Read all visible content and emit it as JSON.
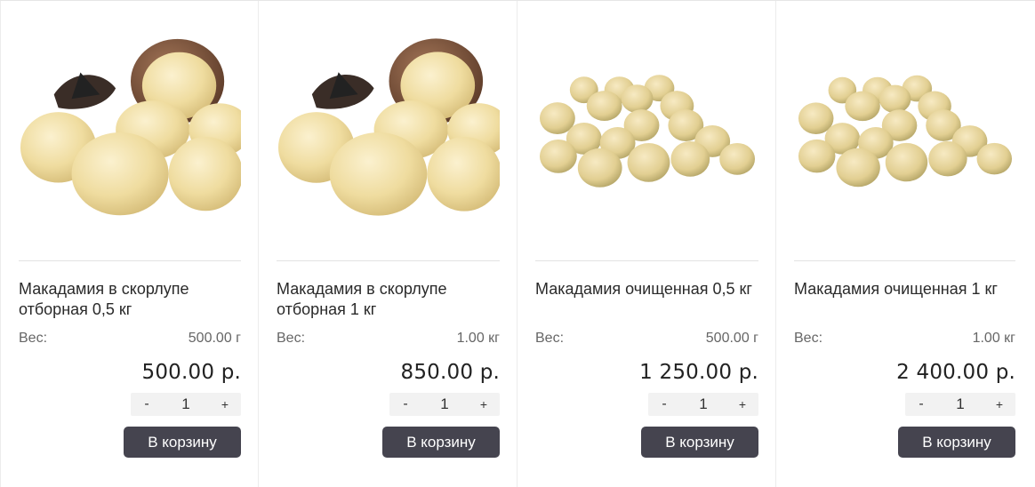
{
  "products": [
    {
      "title": "Макадамия в скорлупе отборная 0,5 кг",
      "weight_label": "Вес:",
      "weight_value": "500.00 г",
      "price": "500.00 р.",
      "qty": "1",
      "minus": "-",
      "plus": "+",
      "cart": "В корзину",
      "image": "macadamia-in-shell"
    },
    {
      "title": "Макадамия в скорлупе отборная 1 кг",
      "weight_label": "Вес:",
      "weight_value": "1.00 кг",
      "price": "850.00 р.",
      "qty": "1",
      "minus": "-",
      "plus": "+",
      "cart": "В корзину",
      "image": "macadamia-in-shell"
    },
    {
      "title": "Макадамия очищенная 0,5 кг",
      "weight_label": "Вес:",
      "weight_value": "500.00 г",
      "price": "1 250.00 р.",
      "qty": "1",
      "minus": "-",
      "plus": "+",
      "cart": "В корзину",
      "image": "macadamia-shelled"
    },
    {
      "title": "Макадамия очищенная 1 кг",
      "weight_label": "Вес:",
      "weight_value": "1.00 кг",
      "price": "2 400.00 р.",
      "qty": "1",
      "minus": "-",
      "plus": "+",
      "cart": "В корзину",
      "image": "macadamia-shelled"
    }
  ]
}
